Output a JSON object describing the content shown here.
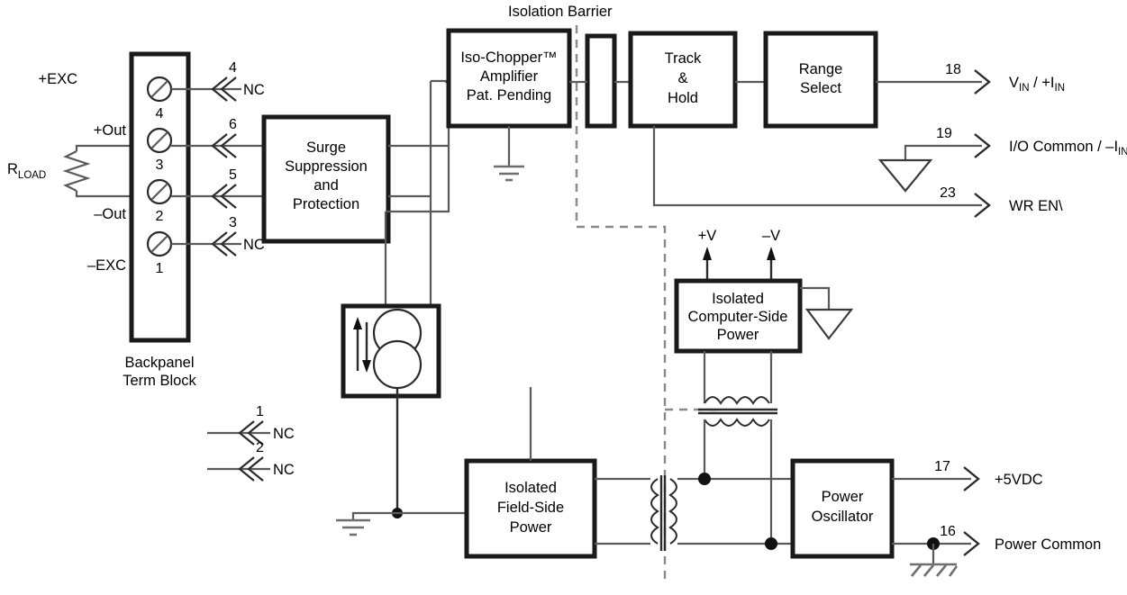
{
  "diagram": {
    "title": "Isolation Barrier",
    "barrier_label": "Isolation Barrier"
  },
  "terminal_block": {
    "caption_line1": "Backpanel",
    "caption_line2": "Term Block",
    "terminals": [
      {
        "screw_number": "4",
        "signal": "+EXC",
        "pin": "4",
        "pin_label": "NC"
      },
      {
        "screw_number": "3",
        "signal": "+Out",
        "pin": "6",
        "pin_label": ""
      },
      {
        "screw_number": "2",
        "signal": "–Out",
        "pin": "5",
        "pin_label": ""
      },
      {
        "screw_number": "1",
        "signal": "–EXC",
        "pin": "3",
        "pin_label": "NC"
      }
    ],
    "load": {
      "label": "R",
      "label_sub": "LOAD"
    },
    "extra_pins": [
      {
        "pin": "1",
        "pin_label": "NC"
      },
      {
        "pin": "2",
        "pin_label": "NC"
      }
    ]
  },
  "blocks": {
    "surge": {
      "lines": [
        "Surge",
        "Suppression",
        "and",
        "Protection"
      ]
    },
    "iso_chopper": {
      "lines": [
        "Iso-Chopper™",
        "Amplifier",
        "Pat. Pending"
      ]
    },
    "track_hold": {
      "lines": [
        "Track",
        "&",
        "Hold"
      ]
    },
    "range_select": {
      "lines": [
        "Range",
        "Select"
      ]
    },
    "isolated_computer_side_power": {
      "lines": [
        "Isolated",
        "Computer-Side",
        "Power"
      ]
    },
    "isolated_field_side_power": {
      "lines": [
        "Isolated",
        "Field-Side",
        "Power"
      ]
    },
    "power_oscillator": {
      "lines": [
        "Power",
        "Oscillator"
      ]
    }
  },
  "rails": {
    "positive": "+V",
    "negative": "–V"
  },
  "outputs": [
    {
      "pin": "18",
      "label_main": "V",
      "label_sub1": "IN",
      "label_mid": " / +I",
      "label_sub2": "IN"
    },
    {
      "pin": "19",
      "label_main": "I/O Common / –I",
      "label_sub1": "IN",
      "label_mid": "",
      "label_sub2": ""
    },
    {
      "pin": "23",
      "label_main": "WR EN\\",
      "label_sub1": "",
      "label_mid": "",
      "label_sub2": ""
    },
    {
      "pin": "17",
      "label_main": "+5VDC",
      "label_sub1": "",
      "label_mid": "",
      "label_sub2": ""
    },
    {
      "pin": "16",
      "label_main": "Power Common",
      "label_sub1": "",
      "label_mid": "",
      "label_sub2": ""
    }
  ],
  "colors": {
    "line": "#5a5a5a",
    "block_border": "#1a1a1a",
    "background": "#ffffff",
    "text": "#000000"
  }
}
